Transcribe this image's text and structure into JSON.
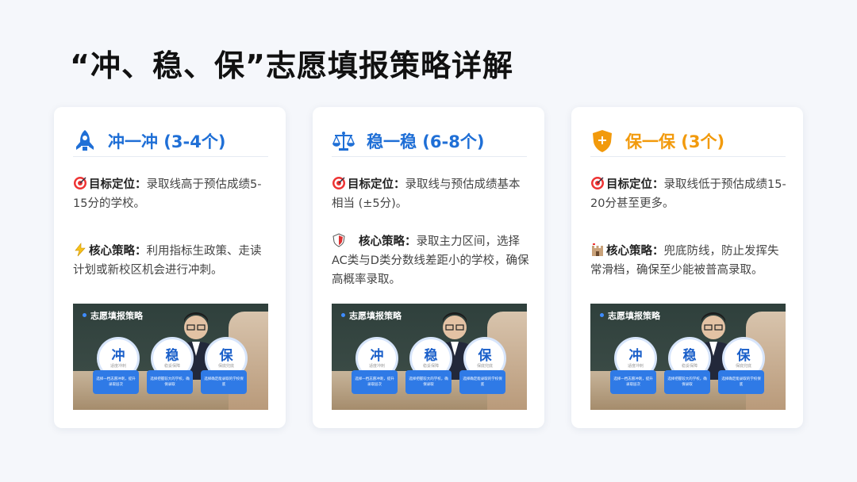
{
  "page_title": "“冲、稳、保”志愿填报策略详解",
  "colors": {
    "blue": "#1f6fd6",
    "orange": "#f29a0c"
  },
  "cards": [
    {
      "icon": "rocket-icon",
      "heading": "冲一冲 (3-4个)",
      "target_label": "目标定位：",
      "target_text": "录取线高于预估成绩5-15分的学校。",
      "target_emoji": "target-emoji",
      "strategy_emoji": "lightning-emoji",
      "strategy_label": "核心策略：",
      "strategy_text": "利用指标生政策、走读计划或新校区机会进行冲刺。"
    },
    {
      "icon": "scale-icon",
      "heading": "稳一稳 (6-8个)",
      "target_label": "目标定位：",
      "target_text": "录取线与预估成绩基本相当 (±5分)。",
      "target_emoji": "target-emoji",
      "strategy_emoji": "shield-emoji",
      "strategy_label": "核心策略：",
      "strategy_text": "录取主力区间，选择AC类与D类分数线差距小的学校，确保高概率录取。"
    },
    {
      "icon": "shield-plus-icon",
      "heading": "保一保 (3个)",
      "target_label": "目标定位：",
      "target_text": "录取线低于预估成绩15-20分甚至更多。",
      "target_emoji": "target-emoji",
      "strategy_emoji": "castle-emoji",
      "strategy_label": "核心策略：",
      "strategy_text": "兜底防线，防止发挥失常滑档，确保至少能被普高录取。"
    }
  ],
  "thumbnail": {
    "title": "志愿填报策略",
    "circles": [
      {
        "big": "冲",
        "small": "适度冲刺",
        "note": "选择一档志愿冲刺，提升录取层次"
      },
      {
        "big": "稳",
        "small": "稳妥保障",
        "note": "选择把握较大的学校，确保录取"
      },
      {
        "big": "保",
        "small": "保底兜底",
        "note": "选择确定能录取的学校保底"
      }
    ]
  }
}
